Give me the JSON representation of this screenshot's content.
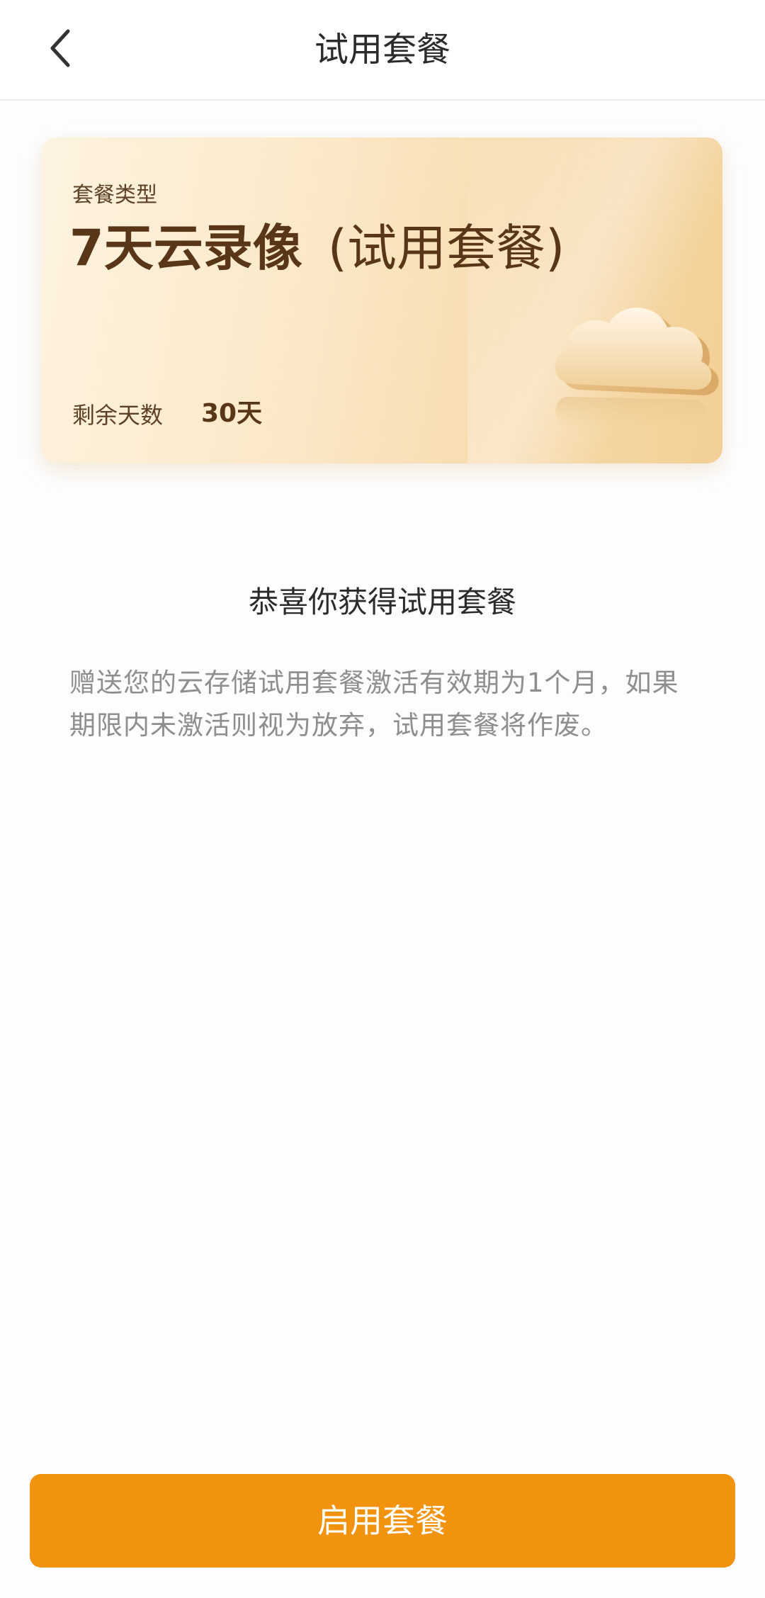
{
  "header": {
    "title": "试用套餐",
    "back_icon": "chevron-left-icon"
  },
  "card": {
    "type_label": "套餐类型",
    "plan_name": "7天云录像",
    "plan_suffix": "(试用套餐)",
    "remaining_label": "剩余天数",
    "remaining_value": "30天",
    "decoration_icon": "cloud-icon",
    "colors": {
      "gradient_start": "#fdf3e1",
      "gradient_end": "#f2cf96",
      "text": "#5a3618"
    }
  },
  "main": {
    "congrats_title": "恭喜你获得试用套餐",
    "notice_text": "赠送您的云存储试用套餐激活有效期为1个月，如果期限内未激活则视为放弃，试用套餐将作废。"
  },
  "footer": {
    "activate_label": "启用套餐"
  },
  "colors": {
    "accent": "#f29310",
    "title_text": "#2b2b2b",
    "muted_text": "#8e8e8e"
  }
}
